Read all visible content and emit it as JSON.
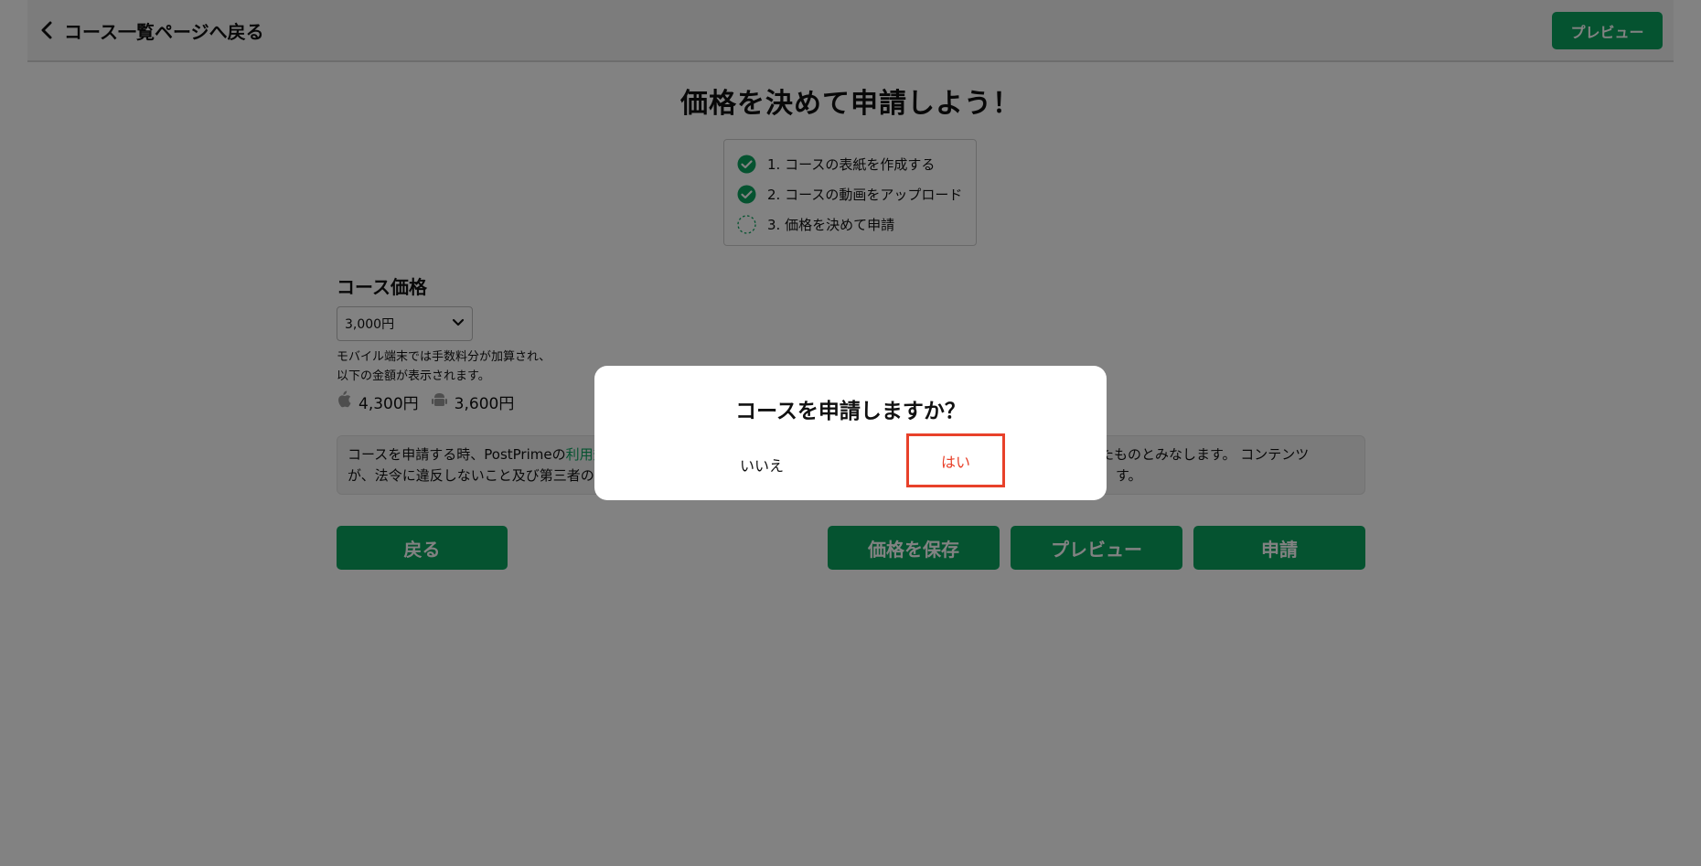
{
  "header": {
    "back_label": "コース一覧ページへ戻る",
    "preview_label": "プレビュー"
  },
  "page_title": "価格を決めて申請しよう！",
  "steps": [
    {
      "label": "1. コースの表紙を作成する",
      "status": "done"
    },
    {
      "label": "2. コースの動画をアップロード",
      "status": "done"
    },
    {
      "label": "3. 価格を決めて申請",
      "status": "pending"
    }
  ],
  "price": {
    "section_title": "コース価格",
    "selected": "3,000円",
    "note_line1": "モバイル端末では手数料分が加算され、",
    "note_line2": "以下の金額が表示されます。",
    "apple_price": "4,300円",
    "android_price": "3,600円"
  },
  "terms": {
    "line1_start": "コースを申請する時、PostPrimeの",
    "link": "利用規",
    "line1_end": "したものとみなします。 コンテンツ",
    "line2_start": "が、法令に違反しないこと及び第三者の",
    "line2_end": "す。"
  },
  "actions": {
    "back_label": "戻る",
    "save_label": "価格を保存",
    "preview_label": "プレビュー",
    "submit_label": "申請"
  },
  "modal": {
    "title": "コースを申請しますか？",
    "no_label": "いいえ",
    "yes_label": "はい"
  },
  "colors": {
    "accent": "#0aa35f",
    "highlight": "#e8412a"
  }
}
